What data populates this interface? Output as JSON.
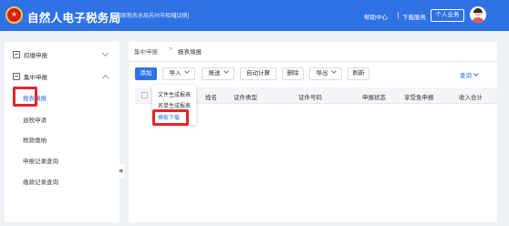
{
  "header": {
    "title": "自然人电子税务局",
    "bureau": "国家税务总局苏州市相城...",
    "switch_label": "[切换]",
    "help": "帮助中心",
    "download": "下载服务",
    "personal": "个人业务",
    "colors": {
      "bar": "#2f72e4",
      "text": "#ffffff"
    }
  },
  "sidebar": {
    "groups": [
      {
        "label": "扣缴申报",
        "icon": "document-icon",
        "expanded": false
      },
      {
        "label": "集中申报",
        "icon": "document-icon",
        "expanded": true
      }
    ],
    "items": [
      {
        "label": "报表填报",
        "active": true
      },
      {
        "label": "退税申请"
      },
      {
        "label": "税款缴纳"
      },
      {
        "label": "申报记录查询"
      },
      {
        "label": "缴款记录查询"
      }
    ],
    "collapse_glyph": "◀"
  },
  "main": {
    "breadcrumb": {
      "tab1": "集中申报",
      "sep": ">",
      "tab2": "报表填报"
    },
    "toolbar": {
      "add": "添加",
      "import": "导入",
      "submit": "报送",
      "auto_calc": "自动计算",
      "delete": "删除",
      "export": "导出",
      "refresh": "刷新",
      "query": "查询"
    },
    "table": {
      "columns": [
        "姓名",
        "证件类型",
        "证件号码",
        "申报状态",
        "享受免申报",
        "收入合计"
      ]
    },
    "dropdown_items": [
      "文件生成报表",
      "名单生成报表",
      "模板下载"
    ]
  },
  "colors": {
    "accent": "#2f72e4",
    "highlight": "#e3262a"
  }
}
